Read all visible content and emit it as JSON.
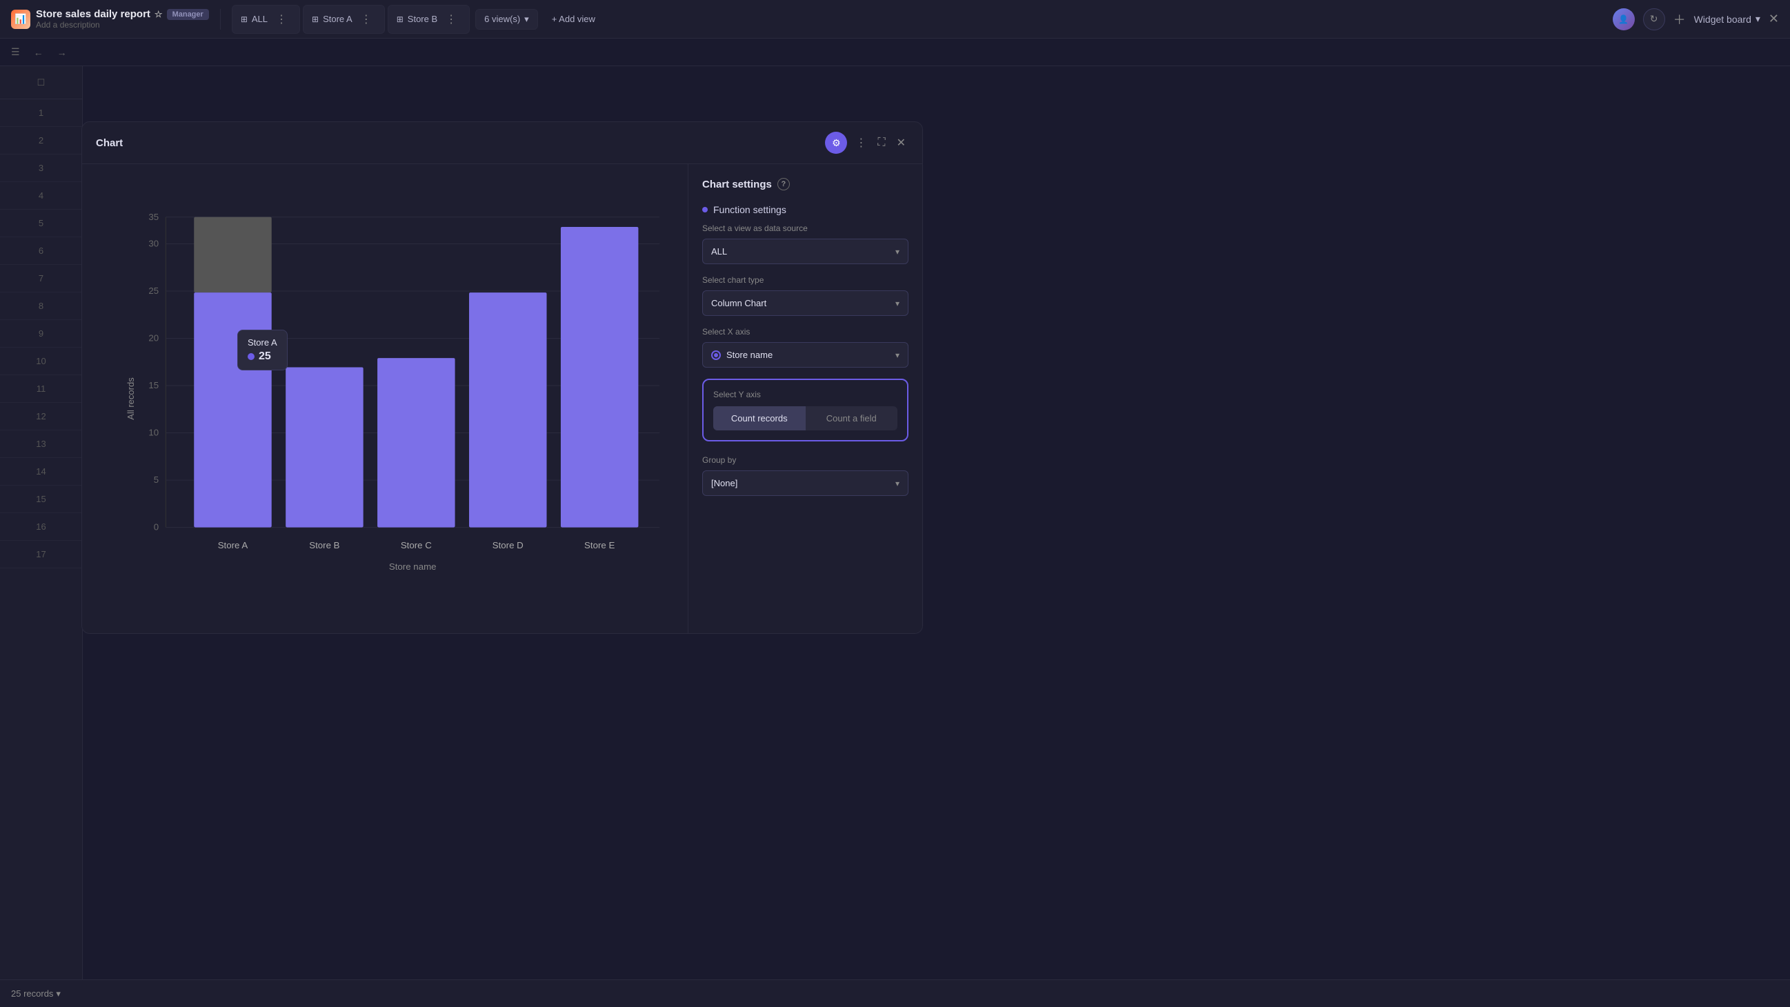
{
  "header": {
    "app_icon": "📊",
    "title": "Store sales daily report",
    "badge": "Manager",
    "add_description": "Add a description",
    "tabs": [
      {
        "label": "ALL",
        "icon": "⊞"
      },
      {
        "label": "Store A",
        "icon": "⊞"
      },
      {
        "label": "Store B",
        "icon": "⊞"
      }
    ],
    "views_count": "6 view(s)",
    "add_view": "+ Add view",
    "widget_board": "Widget board",
    "close": "✕"
  },
  "modal": {
    "title": "Chart",
    "chart": {
      "y_axis_label": "All records",
      "x_axis_label": "Store name",
      "bars": [
        {
          "label": "Store A",
          "value": 25,
          "highlighted": true
        },
        {
          "label": "Store B",
          "value": 17
        },
        {
          "label": "Store C",
          "value": 18
        },
        {
          "label": "Store D",
          "value": 25
        },
        {
          "label": "Store E",
          "value": 33
        }
      ],
      "y_max": 35,
      "y_ticks": [
        0,
        5,
        10,
        15,
        20,
        25,
        30,
        35
      ],
      "tooltip": {
        "store": "Store A",
        "value": "25"
      }
    },
    "settings": {
      "title": "Chart settings",
      "section_label": "Function settings",
      "data_source_label": "Select a view as data source",
      "data_source_value": "ALL",
      "chart_type_label": "Select chart type",
      "chart_type_value": "Column Chart",
      "x_axis_label": "Select X axis",
      "x_axis_value": "Store name",
      "y_axis_label": "Select Y axis",
      "y_axis_btn1": "Count records",
      "y_axis_btn2": "Count a field",
      "group_by_label": "Group by",
      "group_by_value": "[None]"
    }
  },
  "rows": [
    1,
    2,
    3,
    4,
    5,
    6,
    7,
    8,
    9,
    10,
    11,
    12,
    13,
    14,
    15,
    16,
    17
  ],
  "bottom": {
    "records": "25 records"
  },
  "colors": {
    "bar_normal": "#7c70e8",
    "bar_hovered": "#8a8a9a",
    "accent": "#6c5ce7"
  }
}
